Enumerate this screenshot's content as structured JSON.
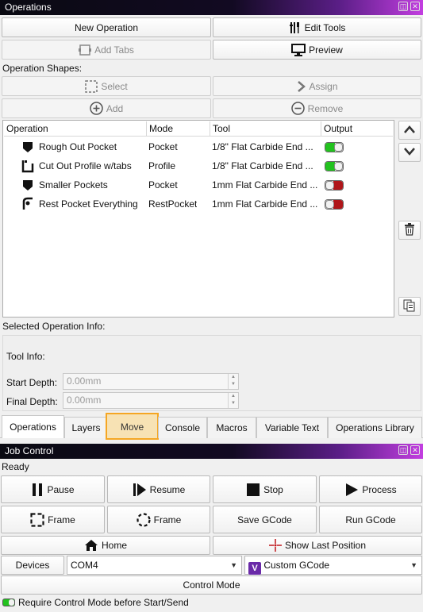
{
  "operations_window": {
    "title": "Operations",
    "buttons": {
      "new_operation": "New Operation",
      "edit_tools": "Edit Tools",
      "add_tabs": "Add Tabs",
      "preview": "Preview",
      "select": "Select",
      "assign": "Assign",
      "add": "Add",
      "remove": "Remove"
    },
    "shapes_label": "Operation Shapes:",
    "table": {
      "columns": [
        "Operation",
        "Mode",
        "Tool",
        "Output"
      ],
      "rows": [
        {
          "name": "Rough Out Pocket",
          "mode": "Pocket",
          "tool": "1/8\" Flat Carbide End ...",
          "output": true,
          "icon": "pocket-icon"
        },
        {
          "name": "Cut Out Profile w/tabs",
          "mode": "Profile",
          "tool": "1/8\" Flat Carbide End ...",
          "output": true,
          "icon": "profile-icon"
        },
        {
          "name": "Smaller Pockets",
          "mode": "Pocket",
          "tool": "1mm Flat Carbide End ...",
          "output": false,
          "icon": "pocket-icon"
        },
        {
          "name": "Rest Pocket Everything",
          "mode": "RestPocket",
          "tool": "1mm Flat Carbide End ...",
          "output": false,
          "icon": "rest-pocket-icon"
        }
      ]
    },
    "selected_info_label": "Selected Operation Info:",
    "tool_info_label": "Tool Info:",
    "start_depth": {
      "label": "Start Depth:",
      "placeholder": "0.00mm"
    },
    "final_depth": {
      "label": "Final Depth:",
      "placeholder": "0.00mm"
    }
  },
  "tabs": [
    "Operations",
    "Layers",
    "Move",
    "Console",
    "Macros",
    "Variable Text",
    "Operations Library"
  ],
  "job_window": {
    "title": "Job Control",
    "status": "Ready",
    "buttons": {
      "pause": "Pause",
      "resume": "Resume",
      "stop": "Stop",
      "process": "Process",
      "frame_rect": "Frame",
      "frame_round": "Frame",
      "save_gcode": "Save GCode",
      "run_gcode": "Run GCode",
      "home": "Home",
      "show_last_position": "Show Last Position",
      "devices": "Devices",
      "control_mode": "Control Mode"
    },
    "port": "COM4",
    "gcode_select": "Custom GCode",
    "require_control_mode": "Require Control Mode before Start/Send"
  },
  "colors": {
    "toggle_on": "#22c21e",
    "toggle_off": "#b0161a",
    "tab_highlight": "#f5a623",
    "title_accent": "#c23ee0"
  }
}
